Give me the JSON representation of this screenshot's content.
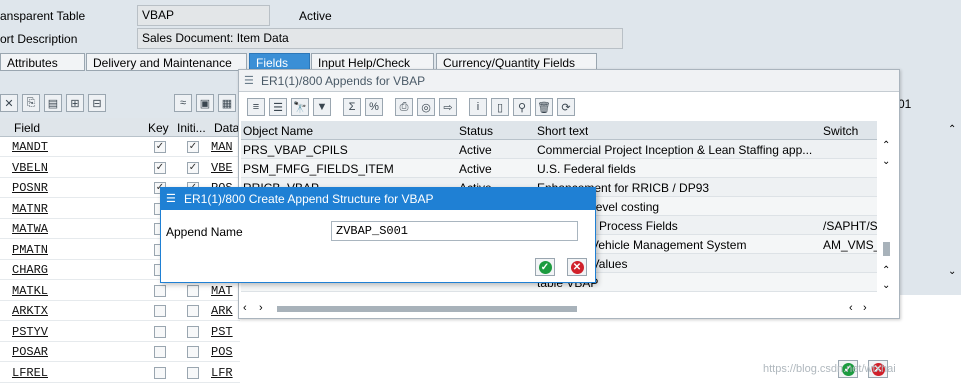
{
  "header": {
    "table_label": "ansparent Table",
    "table_value": "VBAP",
    "status": "Active",
    "desc_label": "ort Description",
    "desc_value": "Sales Document: Item Data"
  },
  "tabs": [
    {
      "label": "Attributes"
    },
    {
      "label": "Delivery and Maintenance"
    },
    {
      "label": "Fields"
    },
    {
      "label": "Input Help/Check"
    },
    {
      "label": "Currency/Quantity Fields"
    }
  ],
  "grid": {
    "headers": {
      "field": "Field",
      "key": "Key",
      "init": "Initi...",
      "data": "Data"
    },
    "rows": [
      {
        "field": "MANDT",
        "key": true,
        "init": true,
        "data": "MAN"
      },
      {
        "field": "VBELN",
        "key": true,
        "init": true,
        "data": "VBE"
      },
      {
        "field": "POSNR",
        "key": true,
        "init": true,
        "data": "POS"
      },
      {
        "field": "MATNR",
        "key": false,
        "init": false,
        "data": ""
      },
      {
        "field": "MATWA",
        "key": false,
        "init": false,
        "data": ""
      },
      {
        "field": "PMATN",
        "key": false,
        "init": false,
        "data": ""
      },
      {
        "field": "CHARG",
        "key": false,
        "init": false,
        "data": ""
      },
      {
        "field": "MATKL",
        "key": false,
        "init": false,
        "data": "MAT"
      },
      {
        "field": "ARKTX",
        "key": false,
        "init": false,
        "data": "ARK"
      },
      {
        "field": "PSTYV",
        "key": false,
        "init": false,
        "data": "PST"
      },
      {
        "field": "POSAR",
        "key": false,
        "init": false,
        "data": "POS"
      },
      {
        "field": "LFREL",
        "key": false,
        "init": false,
        "data": "LFR"
      }
    ],
    "page_frag": "01"
  },
  "appends": {
    "title": "ER1(1)/800 Appends for VBAP",
    "headers": {
      "name": "Object Name",
      "status": "Status",
      "text": "Short text",
      "switch": "Switch"
    },
    "rows": [
      {
        "name": "PRS_VBAP_CPILS",
        "status": "Active",
        "text": "Commercial Project Inception & Lean Staffing app...",
        "switch": ""
      },
      {
        "name": "PSM_FMFG_FIELDS_ITEM",
        "status": "Active",
        "text": "U.S. Federal fields",
        "switch": ""
      },
      {
        "name": "RRICB_VBAP",
        "status": "Active",
        "text": "Enhancement for RRICB / DP93",
        "switch": ""
      },
      {
        "name": "",
        "status": "",
        "text": "Operation level costing",
        "switch": ""
      },
      {
        "name": "",
        "status": "",
        "text": "aintenance Process Fields",
        "switch": "/SAPHT/S"
      },
      {
        "name": "",
        "status": "",
        "text": "ucture for Vehicle Management System",
        "switch": "AM_VMS_"
      },
      {
        "name": "",
        "status": "",
        "text": "racteristic Values",
        "switch": ""
      },
      {
        "name": "",
        "status": "",
        "text": "table VBAP",
        "switch": ""
      }
    ]
  },
  "dialog": {
    "title": "ER1(1)/800 Create Append Structure for VBAP",
    "append_label": "Append Name",
    "append_value": "ZVBAP_S001"
  },
  "watermark": "https://blog.csdn.net/wtxhai",
  "colors": {
    "accent": "#1f80d4",
    "ok": "#1c9b3f",
    "cancel": "#d0202a"
  }
}
